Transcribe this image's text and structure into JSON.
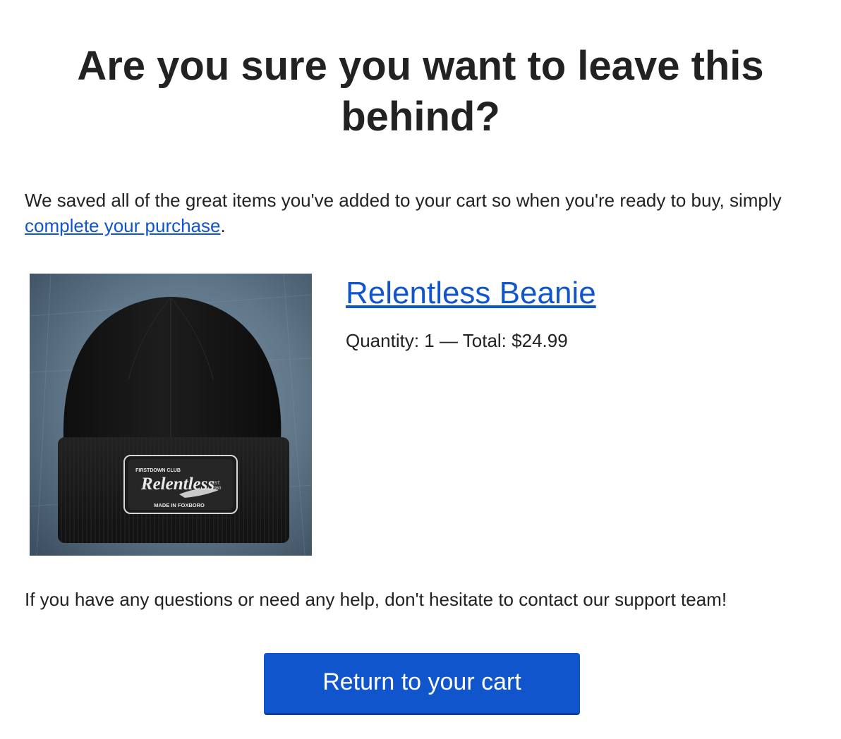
{
  "email": {
    "headline": "Are you sure you want to leave this behind?",
    "intro_before_link": "We saved all of the great items you've added to your cart so when you're ready to buy, simply ",
    "intro_link": "complete your purchase",
    "intro_after_link": ".",
    "help_text": "If you have any questions or need any help, don't hesitate to contact our support team!",
    "button_label": "Return to your cart"
  },
  "product": {
    "name": "Relentless Beanie",
    "quantity_label": "Quantity:",
    "quantity": "1",
    "separator": "—",
    "total_label": "Total:",
    "total": "$24.99",
    "image_alt": "Black knit beanie with Relentless patch",
    "patch": {
      "brand": "Relentless",
      "club": "FIRSTDOWN CLUB",
      "est_label": "EST.",
      "est_year": "1960",
      "made_in": "MADE IN FOXBORO"
    }
  },
  "colors": {
    "link": "#1155cc",
    "button_bg": "#1155cc",
    "text": "#222222",
    "image_bg": "#5a7285",
    "beanie": "#161616"
  },
  "icons": {
    "product_image": "beanie-image"
  }
}
